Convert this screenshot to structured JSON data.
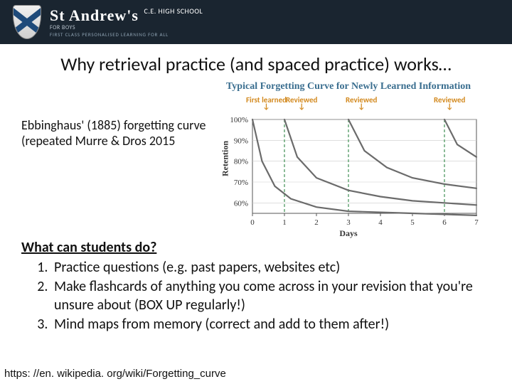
{
  "header": {
    "school_name": "St Andrew's",
    "school_suffix": "C.E. HIGH SCHOOL",
    "school_for": "FOR BOYS",
    "tagline": "FIRST CLASS PERSONALISED LEARNING FOR ALL"
  },
  "title": "Why retrieval practice (and spaced practice) works…",
  "left_text_1": "Ebbinghaus' (1885) forgetting curve",
  "left_text_2": "(repeated Murre & Dros 2015",
  "chart_title": "Typical Forgetting Curve for Newly Learned Information",
  "chart_annot": {
    "first": "First learned",
    "reviewed": "Reviewed"
  },
  "chart_axes": {
    "y": "Retention",
    "x": "Days"
  },
  "question_head": "What can students do?",
  "items": [
    "Practice questions (e.g. past papers, websites etc)",
    "Make flashcards of anything you come across in your revision that you're unsure about (BOX UP regularly!)",
    "Mind maps from memory (correct and add to them after!)"
  ],
  "footer": "https: //en. wikipedia. org/wiki/Forgetting_curve",
  "chart_data": {
    "type": "line",
    "title": "Typical Forgetting Curve for Newly Learned Information",
    "xlabel": "Days",
    "ylabel": "Retention",
    "xlim": [
      0,
      7
    ],
    "ylim": [
      55,
      100
    ],
    "y_ticks": [
      "100%",
      "90%",
      "80%",
      "70%",
      "60%"
    ],
    "x_ticks": [
      "0",
      "1",
      "2",
      "3",
      "4",
      "5",
      "6",
      "7"
    ],
    "review_days": [
      0,
      1,
      3,
      6
    ],
    "series": [
      {
        "name": "curve1",
        "x": [
          0,
          0.3,
          0.7,
          1.2,
          2,
          3,
          5,
          7
        ],
        "y": [
          100,
          80,
          68,
          62,
          58,
          56,
          55,
          54
        ]
      },
      {
        "name": "curve2",
        "x": [
          1,
          1.4,
          2,
          3,
          4,
          5,
          7
        ],
        "y": [
          100,
          82,
          72,
          66,
          63,
          61,
          59
        ]
      },
      {
        "name": "curve3",
        "x": [
          3,
          3.5,
          4.2,
          5,
          6,
          7
        ],
        "y": [
          100,
          85,
          77,
          72,
          69,
          67
        ]
      },
      {
        "name": "curve4",
        "x": [
          6,
          6.4,
          7
        ],
        "y": [
          100,
          88,
          82
        ]
      }
    ],
    "annotations": [
      {
        "text": "First learned",
        "x": 0
      },
      {
        "text": "Reviewed",
        "x": 1
      },
      {
        "text": "Reviewed",
        "x": 3
      },
      {
        "text": "Reviewed",
        "x": 6
      }
    ]
  }
}
